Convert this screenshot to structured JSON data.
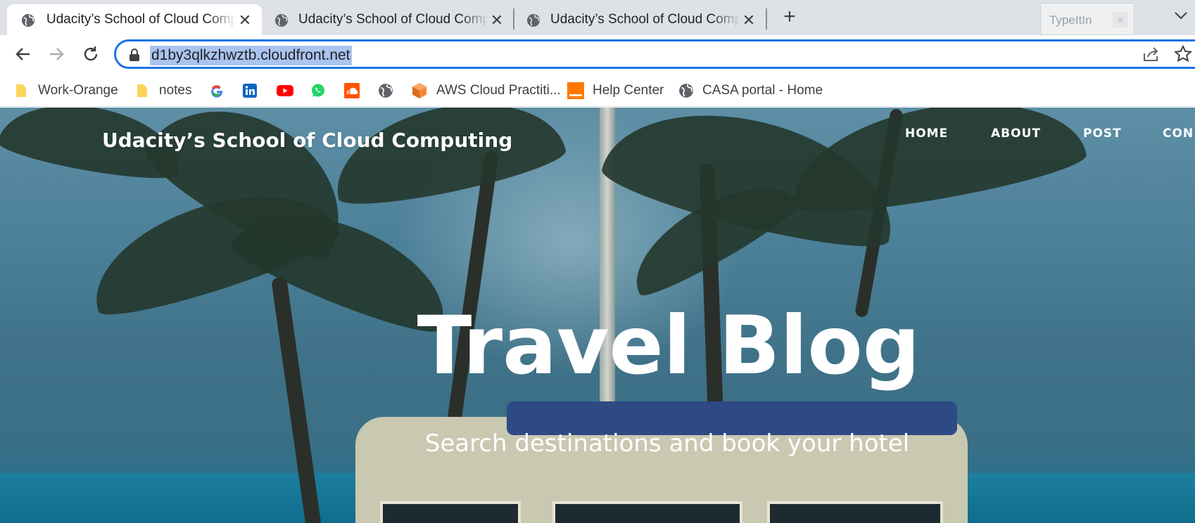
{
  "browser": {
    "tabs": [
      {
        "title": "Udacity’s School of Cloud Computing",
        "active": true
      },
      {
        "title": "Udacity’s School of Cloud Computing",
        "active": false
      },
      {
        "title": "Udacity’s School of Cloud Computing",
        "active": false
      }
    ],
    "extension_popup": {
      "label": "TypeItIn"
    },
    "url": "d1by3qlkzhwztb.cloudfront.net",
    "accent_color": "#1a73e8",
    "bookmarks": [
      {
        "label": "Work-Orange",
        "icon": "folder-icon"
      },
      {
        "label": "notes",
        "icon": "folder-icon"
      },
      {
        "label": "",
        "icon": "google-icon"
      },
      {
        "label": "",
        "icon": "linkedin-icon"
      },
      {
        "label": "",
        "icon": "youtube-icon"
      },
      {
        "label": "",
        "icon": "whatsapp-icon"
      },
      {
        "label": "",
        "icon": "soundcloud-icon"
      },
      {
        "label": "",
        "icon": "globe-icon"
      },
      {
        "label": "AWS Cloud Practiti...",
        "icon": "aws-cube-icon"
      },
      {
        "label": "Help Center",
        "icon": "orange-logo-icon"
      },
      {
        "label": "CASA portal - Home",
        "icon": "globe-icon"
      }
    ]
  },
  "page": {
    "site_title": "Udacity’s School of Cloud Computing",
    "nav": [
      "HOME",
      "ABOUT",
      "POST",
      "CON"
    ],
    "hero_title": "Travel Blog",
    "hero_subtitle": "Search destinations and book your hotel"
  }
}
